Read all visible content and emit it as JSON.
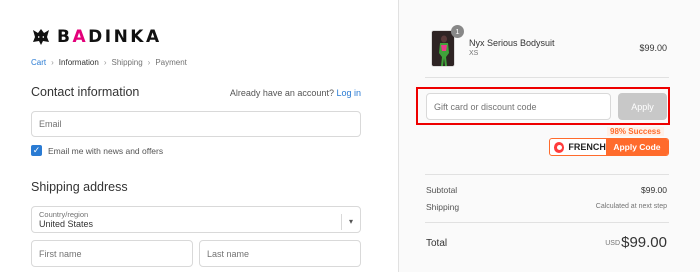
{
  "brand": {
    "logo_prefix": "B",
    "logo_accent": "A",
    "logo_suffix": "DINKA"
  },
  "breadcrumb": [
    {
      "label": "Cart",
      "state": "link"
    },
    {
      "label": "Information",
      "state": "current"
    },
    {
      "label": "Shipping",
      "state": "upcoming"
    },
    {
      "label": "Payment",
      "state": "upcoming"
    }
  ],
  "contact": {
    "title": "Contact information",
    "account_prompt": "Already have an account?",
    "login_label": "Log in",
    "email_placeholder": "Email",
    "newsletter_label": "Email me with news and offers",
    "newsletter_checked": true
  },
  "shipping": {
    "title": "Shipping address",
    "country_label": "Country/region",
    "country_value": "United States",
    "first_name_placeholder": "First name",
    "last_name_placeholder": "Last name"
  },
  "cart": {
    "item": {
      "name": "Nyx Serious Bodysuit",
      "variant": "XS",
      "price": "$99.00",
      "quantity": "1"
    },
    "discount": {
      "placeholder": "Gift card or discount code",
      "apply_label": "Apply"
    },
    "coupon_widget": {
      "success_text": "98% Success",
      "brand": "FRENCH",
      "apply_label": "Apply Code"
    },
    "summary": {
      "subtotal_label": "Subtotal",
      "subtotal_value": "$99.00",
      "shipping_label": "Shipping",
      "shipping_value": "Calculated at next step",
      "total_label": "Total",
      "total_currency": "USD",
      "total_value": "$99.00"
    }
  },
  "colors": {
    "accent": "#2a7bd3",
    "brand_pink": "#e3007a",
    "highlight": "#ee0000",
    "coupon_orange": "#ff6b2c"
  }
}
